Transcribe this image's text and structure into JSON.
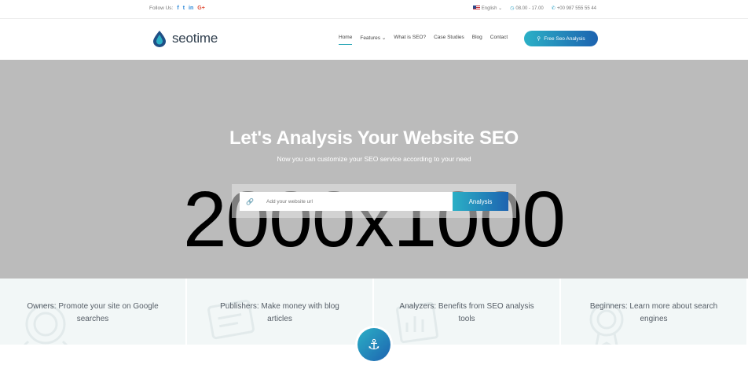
{
  "topbar": {
    "follow_label": "Follow Us:",
    "social": [
      "f",
      "t",
      "in",
      "G+"
    ],
    "language": "English",
    "hours": "08.00 - 17.00",
    "phone": "+00 987 555 55 44"
  },
  "header": {
    "logo_text": "seotime",
    "nav": [
      {
        "label": "Home",
        "active": true
      },
      {
        "label": "Features",
        "dropdown": true
      },
      {
        "label": "What is SEO?"
      },
      {
        "label": "Case Studies"
      },
      {
        "label": "Blog"
      },
      {
        "label": "Contact"
      }
    ],
    "cta_label": "Free Seo Analysis"
  },
  "hero": {
    "placeholder_text": "2000x1000",
    "title": "Let's Analysis Your Website SEO",
    "subtitle": "Now you can customize your SEO service according to your need",
    "search_placeholder": "Add your website url",
    "button_label": "Analysis"
  },
  "features": [
    {
      "text": "Owners: Promote your site on Google searches",
      "icon": "astronaut-icon"
    },
    {
      "text": "Publishers: Make money with blog articles",
      "icon": "article-icon"
    },
    {
      "text": "Analyzers: Benefits from SEO analysis tools",
      "icon": "analytics-icon"
    },
    {
      "text": "Beginners: Learn more about search engines",
      "icon": "award-icon"
    }
  ],
  "colors": {
    "accent_start": "#2bb0c6",
    "accent_end": "#1d63b0",
    "hero_bg": "#bbbbbb"
  }
}
